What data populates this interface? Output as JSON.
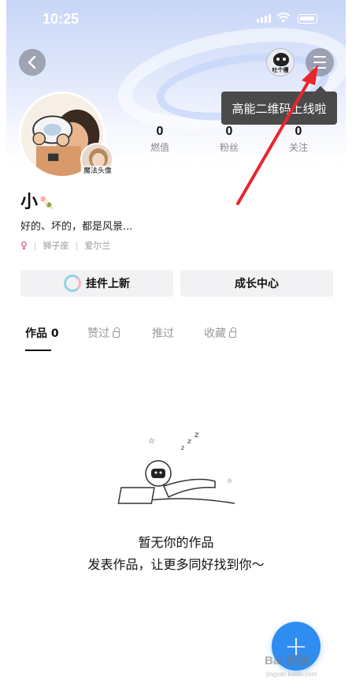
{
  "status_bar": {
    "time": "10:25"
  },
  "top_nav": {
    "mascot_label": "吐个槽"
  },
  "tooltip": {
    "text": "高能二维码上线啦"
  },
  "profile": {
    "avatar_badge": "魔法头像",
    "username": "小",
    "username_emoji": "🍡",
    "bio": "好的、坏的，都是风景...",
    "gender_icon": "female-icon",
    "zodiac": "狮子座",
    "location": "爱尔兰",
    "stats": [
      {
        "value": "0",
        "label": "燃值"
      },
      {
        "value": "0",
        "label": "粉丝"
      },
      {
        "value": "0",
        "label": "关注"
      }
    ]
  },
  "actions": {
    "pendant_label": "挂件上新",
    "growth_label": "成长中心"
  },
  "tabs": [
    {
      "label": "作品 0",
      "active": true
    },
    {
      "label": "赞过",
      "locked": true
    },
    {
      "label": "推过"
    },
    {
      "label": "收藏",
      "locked": true
    }
  ],
  "empty_state": {
    "title": "暂无你的作品",
    "subtitle": "发表作品，让更多同好找到你～"
  },
  "fab": {
    "symbol": "+",
    "watermark": "Bai 经验",
    "watermark_sub": "jingyan.baidu.com"
  },
  "colors": {
    "accent": "#2f8cf0",
    "arrow": "#e8262c",
    "tooltip_bg": "#4a4a4a"
  }
}
